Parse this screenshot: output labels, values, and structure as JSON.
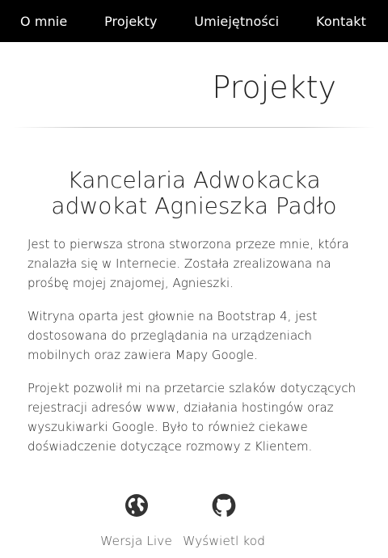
{
  "nav": {
    "items": [
      {
        "label": "O mnie"
      },
      {
        "label": "Projekty"
      },
      {
        "label": "Umiejętności"
      },
      {
        "label": "Kontakt"
      }
    ]
  },
  "page": {
    "title": "Projekty"
  },
  "project": {
    "title_line1": "Kancelaria Adwokacka",
    "title_line2": "adwokat Agnieszka Padło",
    "paragraphs": [
      "Jest to pierwsza strona stworzona przeze mnie, która znalazła się w Internecie. Została zrealizowana na prośbę mojej znajomej, Agnieszki.",
      "Witryna oparta jest głownie na Bootstrap 4, jest dostosowana do przeglądania na urządzeniach mobilnych oraz zawiera Mapy Google.",
      "Projekt pozwolił mi na przetarcie szlaków dotyczących rejestracji adresów www, działania hostingów oraz wyszukiwarki Google. Było to również ciekawe doświadczenie dotyczące rozmowy z Klientem."
    ],
    "links": {
      "live": {
        "label": "Wersja Live",
        "icon": "globe-icon"
      },
      "code": {
        "label": "Wyświetl kod",
        "icon": "github-icon"
      }
    }
  },
  "colors": {
    "nav_background": "#000000",
    "nav_text": "#ffffff",
    "text": "#222222",
    "link_text": "#555555",
    "icon": "#333333"
  }
}
